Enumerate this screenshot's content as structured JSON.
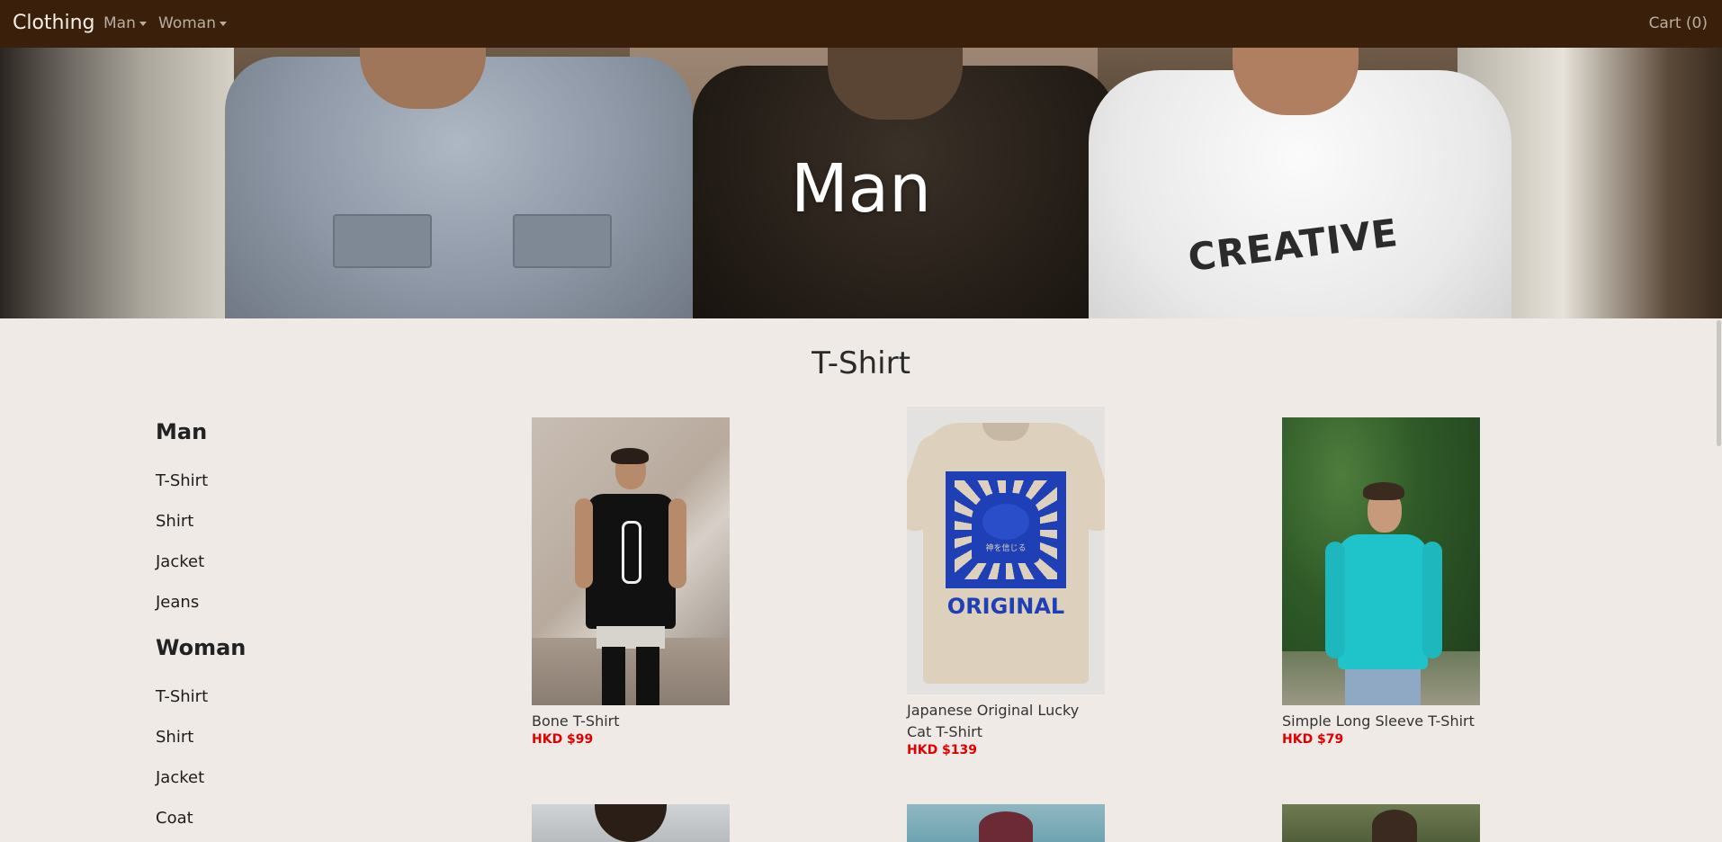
{
  "navbar": {
    "brand": "Clothing",
    "menus": [
      {
        "label": "Man"
      },
      {
        "label": "Woman"
      }
    ],
    "cart": "Cart (0)",
    "bg_color": "#3a200a"
  },
  "hero": {
    "title": "Man",
    "shirt_text": "CREATIVE"
  },
  "section": {
    "title": "T-Shirt"
  },
  "sidebar": {
    "groups": [
      {
        "heading": "Man",
        "links": [
          "T-Shirt",
          "Shirt",
          "Jacket",
          "Jeans"
        ]
      },
      {
        "heading": "Woman",
        "links": [
          "T-Shirt",
          "Shirt",
          "Jacket",
          "Coat"
        ]
      }
    ]
  },
  "products": [
    {
      "name": "Bone T-Shirt",
      "price": "HKD $99"
    },
    {
      "name": "Japanese Original Lucky Cat T-Shirt",
      "price": "HKD $139"
    },
    {
      "name": "Simple Long Sleeve T-Shirt",
      "price": "HKD $79"
    }
  ],
  "lucky_cat_print": {
    "top_text": "神を信じる",
    "bottom_text": "ORIGINAL"
  },
  "colors": {
    "price": "#e00000",
    "page_bg": "#efeae6"
  }
}
